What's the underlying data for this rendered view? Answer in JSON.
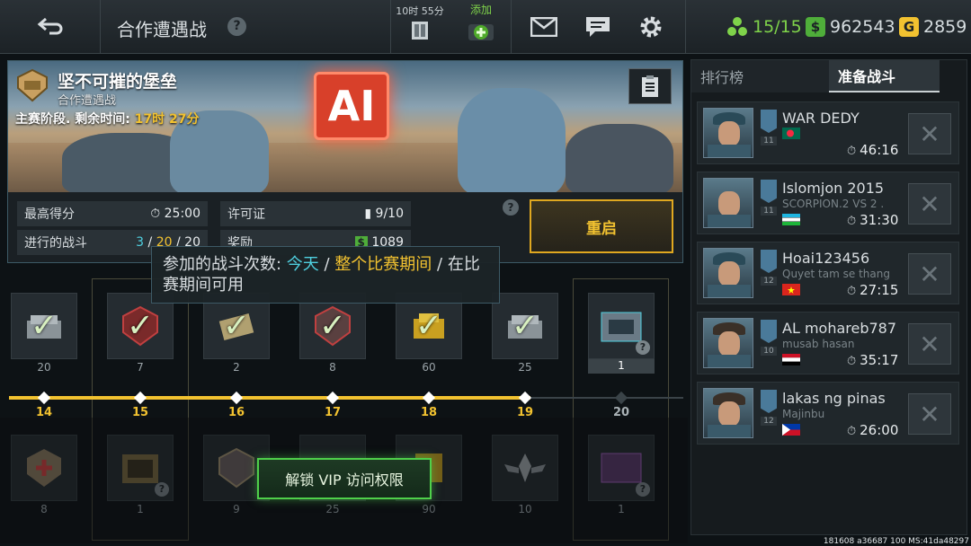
{
  "header": {
    "title": "合作遭遇战",
    "help_glyph": "?",
    "timer_label": "10时 55分",
    "add_label": "添加",
    "energy": "15/15",
    "cash": "962543",
    "gold": "2859",
    "colors": {
      "energy": "#7fd34a",
      "cash": "#4fae3a",
      "gold": "#f2c230"
    }
  },
  "event": {
    "title": "坚不可摧的堡垒",
    "subtitle": "合作遭遇战",
    "stage_label": "主赛阶段. 剩余时间: ",
    "stage_time": "17时 27分",
    "banner_sign": "AI"
  },
  "stats": {
    "best_label": "最高得分",
    "best_value": "25:00",
    "permit_label": "许可证",
    "permit_value": "9/10",
    "battles_label": "进行的战斗",
    "battles_a": "3",
    "battles_sep1": " / ",
    "battles_b": "20",
    "battles_sep2": " / ",
    "battles_c": "20",
    "reward_label": "奖励",
    "reward_value": "1089",
    "restart_label": "重启"
  },
  "tooltip": {
    "prefix": "参加的战斗次数: ",
    "today": "今天",
    "sep1": " / ",
    "whole": "整个比赛期间",
    "sep2": " / ",
    "avail": "在比赛期间可用"
  },
  "track": {
    "top_counts": [
      "20",
      "7",
      "2",
      "8",
      "60",
      "25",
      "1"
    ],
    "levels": [
      "14",
      "15",
      "16",
      "17",
      "18",
      "19",
      "20"
    ],
    "bottom_counts": [
      "8",
      "1",
      "9",
      "25",
      "90",
      "10",
      "1"
    ],
    "vip_label": "解锁 VIP 访问权限"
  },
  "sidebar": {
    "tab_leaderboard": "排行榜",
    "tab_prepare": "准备战斗",
    "players": [
      {
        "name": "WAR DEDY",
        "clan": "",
        "rank": "11",
        "time": "46:16"
      },
      {
        "name": "Islomjon 2015",
        "clan": "SCORPION.2 VS 2 .",
        "rank": "11",
        "time": "31:30"
      },
      {
        "name": "Hoai123456",
        "clan": "Quyet tam se thang",
        "rank": "12",
        "time": "27:15"
      },
      {
        "name": "AL mohareb787",
        "clan": "musab hasan",
        "rank": "10",
        "time": "35:17"
      },
      {
        "name": "lakas ng pinas",
        "clan": "Majinbu",
        "rank": "12",
        "time": "26:00"
      }
    ]
  },
  "footer": "181608 a36687 100 MS:41da48297"
}
